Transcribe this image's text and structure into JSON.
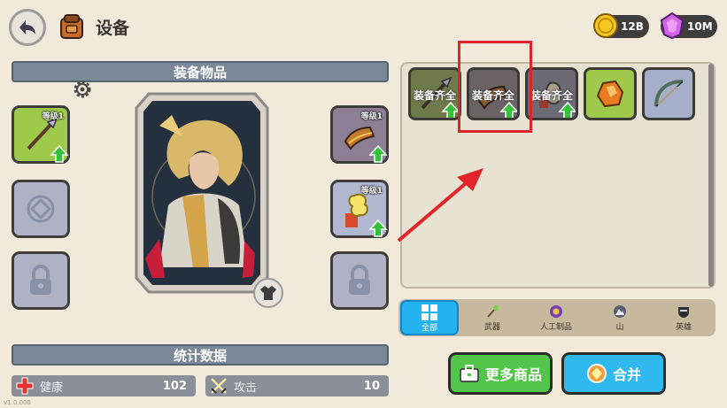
{
  "header": {
    "title": "设备",
    "coins": "12B",
    "gems": "10M"
  },
  "equipment": {
    "banner": "装备物品",
    "left_slots": [
      {
        "type": "weapon",
        "level_label": "等级1",
        "upgradable": true
      },
      {
        "type": "empty"
      },
      {
        "type": "locked"
      }
    ],
    "right_slots": [
      {
        "type": "armor",
        "level_label": "等级1",
        "upgradable": true
      },
      {
        "type": "accessory",
        "level_label": "等级1",
        "upgradable": true
      },
      {
        "type": "locked"
      }
    ]
  },
  "stats": {
    "banner": "统计数据",
    "health_label": "健康",
    "health_value": "102",
    "attack_label": "攻击",
    "attack_value": "10"
  },
  "inventory": {
    "items": [
      {
        "label": "装备齐全",
        "icon": "spear-icon",
        "upgradable": true
      },
      {
        "label": "装备齐全",
        "icon": "bracer-icon",
        "upgradable": true
      },
      {
        "label": "装备齐全",
        "icon": "potion-icon",
        "upgradable": true
      },
      {
        "label": "",
        "icon": "ore-icon",
        "upgradable": false
      },
      {
        "label": "",
        "icon": "bow-icon",
        "upgradable": false
      }
    ]
  },
  "filters": [
    {
      "label": "全部",
      "icon": "grid-icon",
      "active": true
    },
    {
      "label": "武器",
      "icon": "staff-icon",
      "active": false
    },
    {
      "label": "人工制品",
      "icon": "artifact-icon",
      "active": false
    },
    {
      "label": "山",
      "icon": "mountain-icon",
      "active": false
    },
    {
      "label": "英雄",
      "icon": "hero-icon",
      "active": false
    }
  ],
  "buttons": {
    "more_goods": "更多商品",
    "merge": "合并"
  },
  "version": "v1.0.000",
  "colors": {
    "background": "#f1e9da",
    "accent_blue": "#25b3ef",
    "accent_green": "#52c54a",
    "highlight_red": "#e0242a"
  }
}
